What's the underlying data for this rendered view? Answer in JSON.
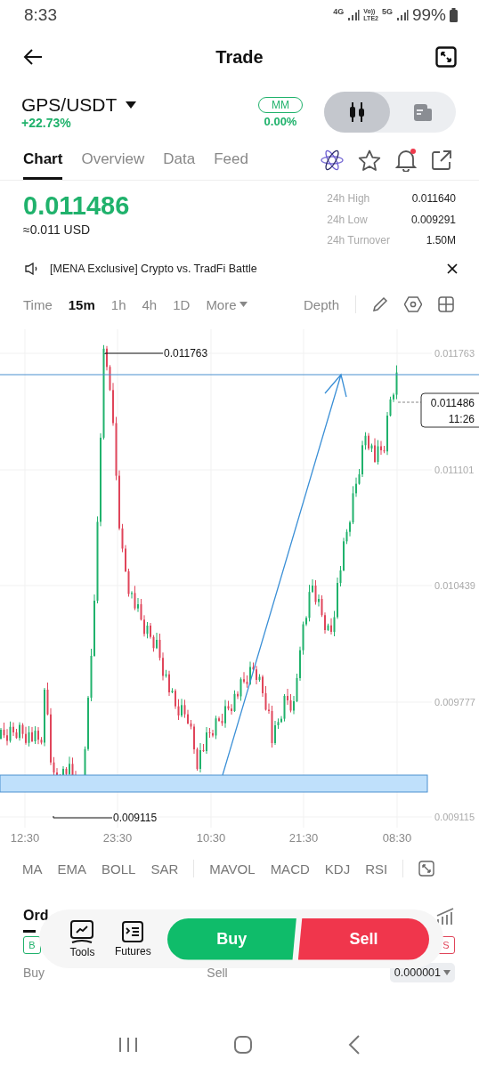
{
  "status_bar": {
    "time": "8:33",
    "network": [
      "4G",
      "Vo))",
      "LTE2",
      "5G"
    ],
    "battery": "99%"
  },
  "header": {
    "title": "Trade"
  },
  "pair": {
    "symbol": "GPS/USDT",
    "change": "+22.73%"
  },
  "mm": {
    "label": "MM",
    "value": "0.00%"
  },
  "view_toggle": [
    {
      "kind": "candles",
      "selected": true
    },
    {
      "kind": "document",
      "selected": false
    }
  ],
  "tabs": [
    {
      "label": "Chart",
      "selected": true
    },
    {
      "label": "Overview",
      "selected": false
    },
    {
      "label": "Data",
      "selected": false
    },
    {
      "label": "Feed",
      "selected": false
    }
  ],
  "alerts_unread": true,
  "price": {
    "last": "0.011486",
    "usd": "≈0.011 USD"
  },
  "stats": [
    {
      "label": "24h High",
      "value": "0.011640"
    },
    {
      "label": "24h Low",
      "value": "0.009291"
    },
    {
      "label": "24h Turnover",
      "value": "1.50M"
    }
  ],
  "announcement": "[MENA Exclusive] Crypto vs. TradFi Battle",
  "intervals": [
    {
      "label": "Time",
      "selected": false
    },
    {
      "label": "15m",
      "selected": true
    },
    {
      "label": "1h",
      "selected": false
    },
    {
      "label": "4h",
      "selected": false
    },
    {
      "label": "1D",
      "selected": false
    },
    {
      "label": "More",
      "selected": false
    }
  ],
  "depth": "Depth",
  "chart": {
    "y_labels": [
      "0.011763",
      "0.011101",
      "0.010439",
      "0.009777",
      "0.009115"
    ],
    "x_labels": [
      "12:30",
      "23:30",
      "10:30",
      "21:30",
      "08:30"
    ],
    "high_label": "0.011763",
    "low_label": "0.009115",
    "last_price": "0.011486",
    "countdown": "11:26"
  },
  "indicators": [
    "MA",
    "EMA",
    "BOLL",
    "SAR",
    "MAVOL",
    "MACD",
    "KDJ",
    "RSI"
  ],
  "orders": {
    "tab": "Ord",
    "buy_badge": "B",
    "sell_badge": "S",
    "buy_heading": "Buy",
    "sell_heading": "Sell",
    "precision": "0.000001"
  },
  "action_bar": {
    "tools": "Tools",
    "futures": "Futures",
    "buy": "Buy",
    "sell": "Sell"
  }
}
